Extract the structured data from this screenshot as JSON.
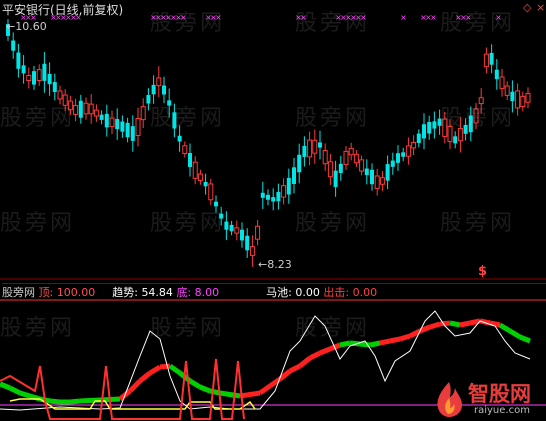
{
  "header": {
    "title": "平安银行(日线,前复权)"
  },
  "price_labels": {
    "high": "10.60",
    "low": "8.23"
  },
  "marker": "$",
  "indicator_legend": {
    "name": "股旁网",
    "top_label": "顶:",
    "top_value": "100.00",
    "trend_label": "趋势:",
    "trend_value": "54.84",
    "bottom_label": "底:",
    "bottom_value": "8.00",
    "horse_label": "马池:",
    "horse_value": "0.00",
    "exit_label": "出击:",
    "exit_value": "0.00"
  },
  "watermark": "股旁网",
  "logo": {
    "text": "智股网",
    "url": "raiyue.com"
  },
  "colors": {
    "up": "#ff3a3a",
    "down": "#00e5e5",
    "trend_up": "#ff2020",
    "trend_down": "#00d000",
    "white": "#ffffff",
    "yellow": "#ffff40",
    "magenta": "#ff40ff",
    "grid": "#8b0000"
  }
}
